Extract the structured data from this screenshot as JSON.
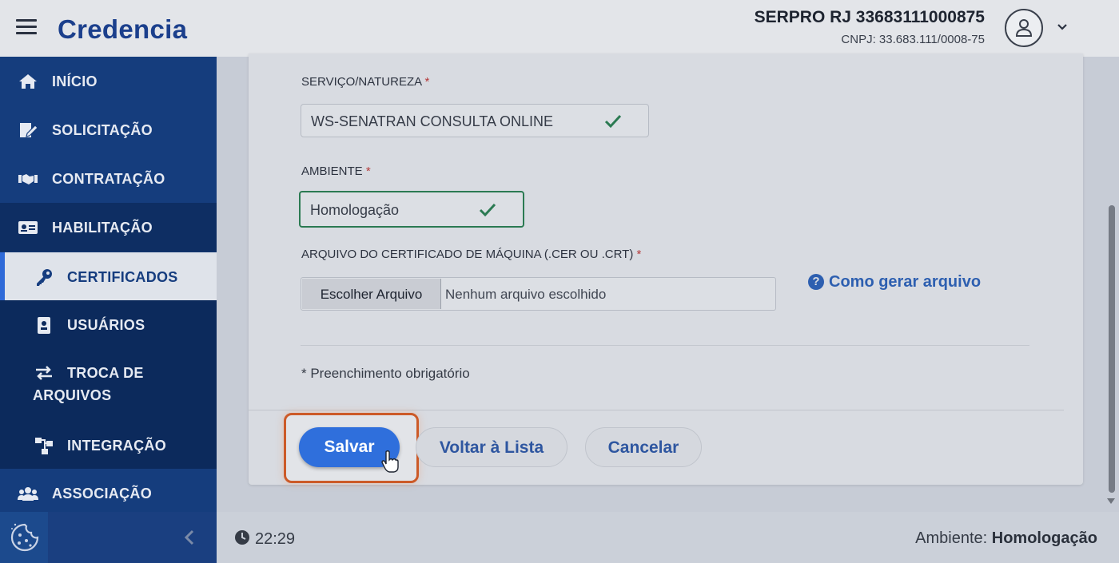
{
  "app": {
    "brand": "Credencia",
    "org_name": "SERPRO RJ 33683111000875",
    "org_cnpj": "CNPJ: 33.683.111/0008-75"
  },
  "sidebar": {
    "items": [
      {
        "label": "INÍCIO",
        "icon": "home-icon"
      },
      {
        "label": "SOLICITAÇÃO",
        "icon": "edit-document-icon"
      },
      {
        "label": "CONTRATAÇÃO",
        "icon": "handshake-icon"
      },
      {
        "label": "HABILITAÇÃO",
        "icon": "id-card-icon"
      },
      {
        "label": "CERTIFICADOS",
        "icon": "key-icon",
        "active": true
      },
      {
        "label": "USUÁRIOS",
        "icon": "badge-icon"
      },
      {
        "label": "TROCA DE ARQUIVOS",
        "line1": "TROCA DE",
        "line2": "ARQUIVOS",
        "icon": "exchange-icon"
      },
      {
        "label": "INTEGRAÇÃO",
        "icon": "sitemap-icon"
      },
      {
        "label": "ASSOCIAÇÃO",
        "icon": "users-icon"
      }
    ]
  },
  "form": {
    "service_label": "SERVIÇO/NATUREZA",
    "service_value": "WS-SENATRAN CONSULTA ONLINE",
    "env_label": "AMBIENTE",
    "env_value": "Homologação",
    "file_label": "ARQUIVO DO CERTIFICADO DE MÁQUINA (.CER OU .CRT)",
    "file_button": "Escolher Arquivo",
    "file_status": "Nenhum arquivo escolhido",
    "help_link": "Como gerar arquivo",
    "required_marker": "*",
    "required_note": "* Preenchimento obrigatório"
  },
  "actions": {
    "save": "Salvar",
    "back": "Voltar à Lista",
    "cancel": "Cancelar"
  },
  "statusbar": {
    "time": "22:29",
    "env_label": "Ambiente:",
    "env_value": "Homologação"
  },
  "colors": {
    "brand": "#1b3f8c",
    "sidebar": "#123773",
    "primary_button": "#2f6fdc",
    "success_check": "#2b7a52",
    "highlight_frame": "#cc5a28"
  }
}
